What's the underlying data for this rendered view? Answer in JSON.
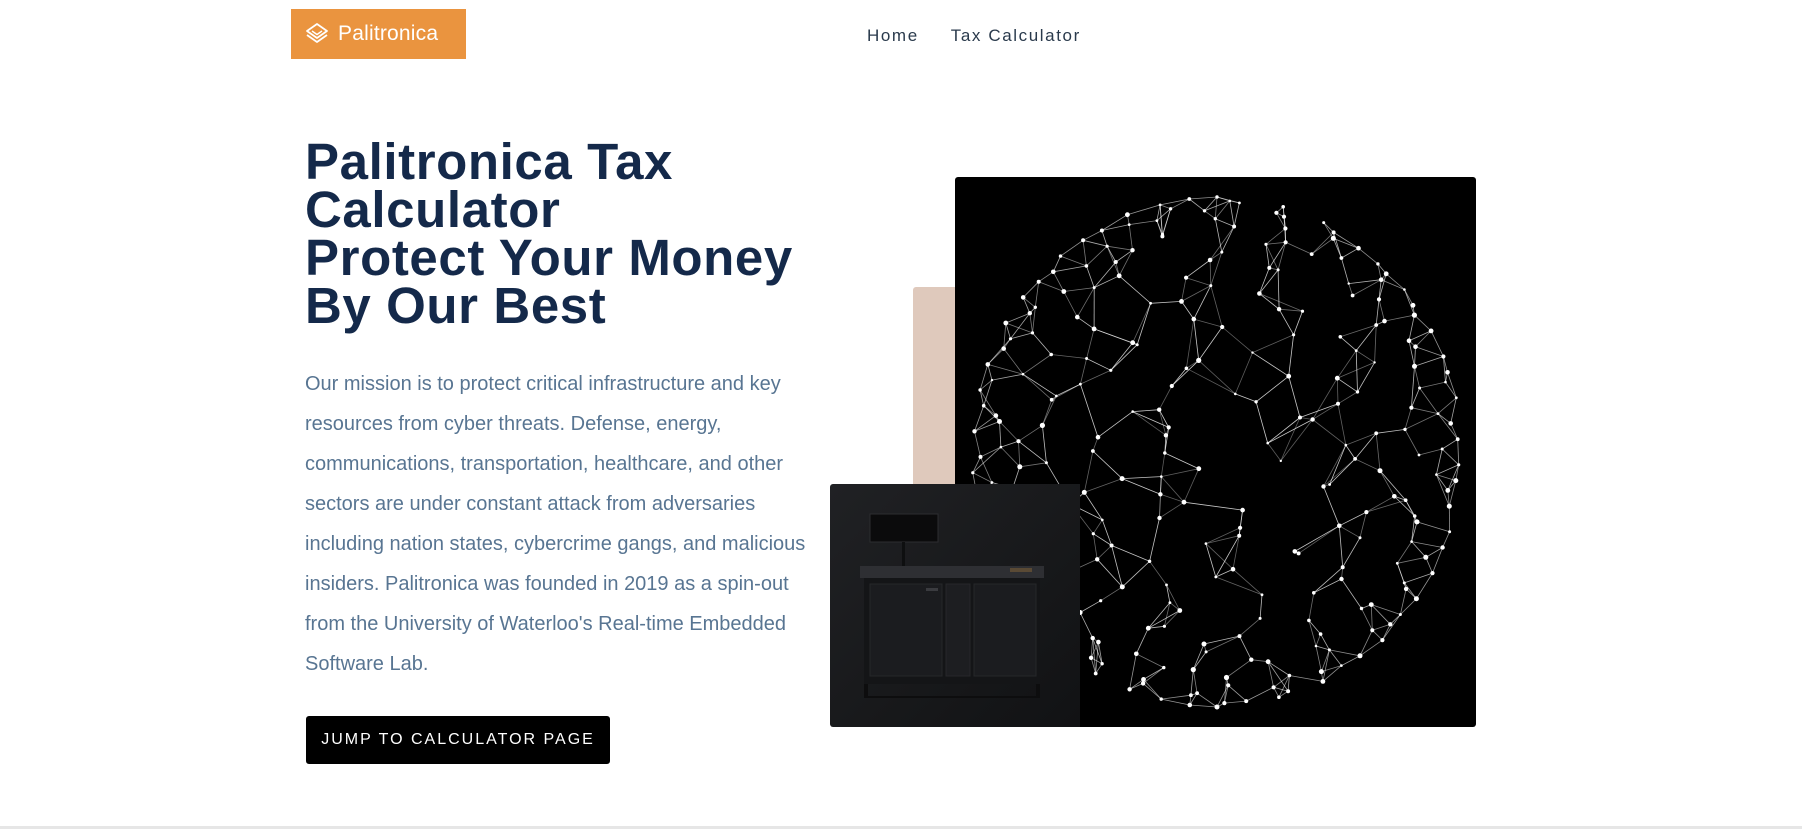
{
  "header": {
    "brand": "Palitronica",
    "brand_icon": "layers-diamond-icon",
    "brand_color": "#ea943f",
    "nav": [
      {
        "label": "Home"
      },
      {
        "label": "Tax Calculator"
      }
    ]
  },
  "hero": {
    "title_lines": [
      "Palitronica Tax",
      "Calculator",
      "Protect Your Money",
      "By Our Best"
    ],
    "description": "Our mission is to protect critical infrastructure and key resources from cyber threats. Defense, energy, communications, transportation, healthcare, and other sectors are under constant attack from adversaries including nation states, cybercrime gangs, and malicious insiders. Palitronica was founded in 2019 as a spin-out from the University of Waterloo's Real-time Embedded Software Lab.",
    "cta_label": "JUMP TO CALCULATOR PAGE"
  },
  "colors": {
    "title": "#14294a",
    "body_text": "#587592",
    "accent_block": "#dfc9bc",
    "cta_background": "#000000"
  }
}
